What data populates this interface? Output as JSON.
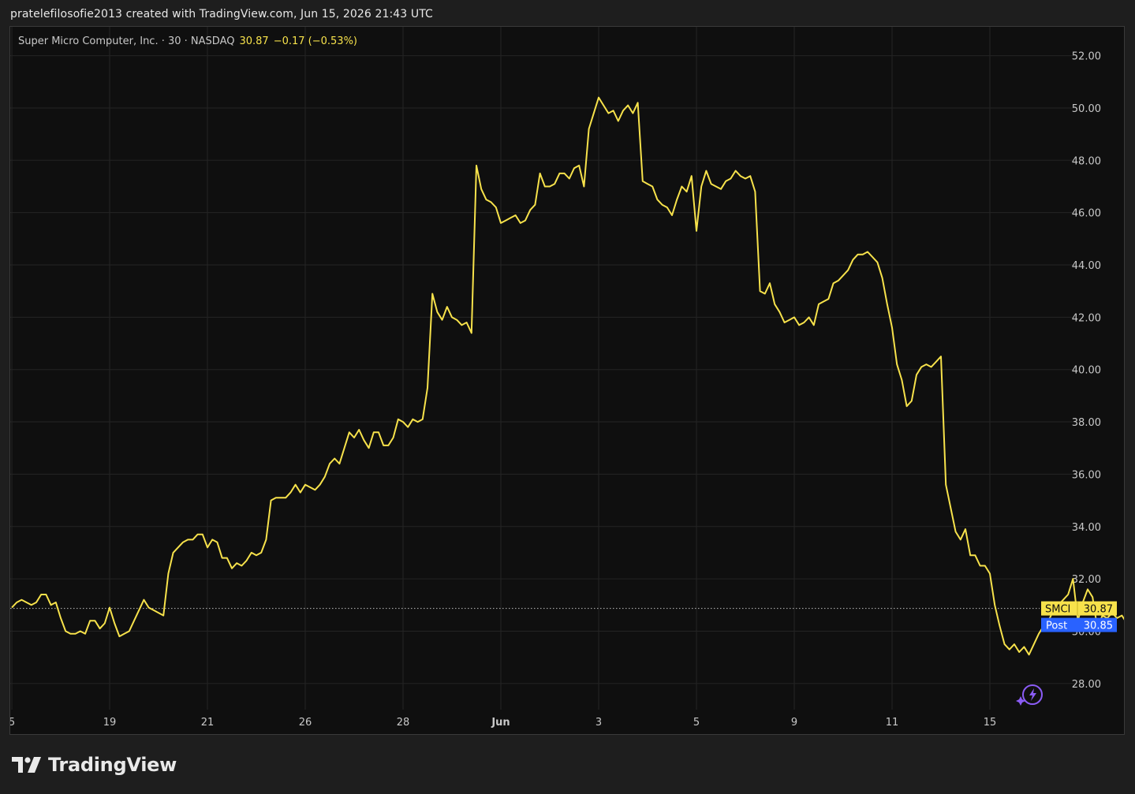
{
  "header": {
    "credit": "pratelefilosofie2013 created with TradingView.com, Jun 15, 2026 21:43 UTC"
  },
  "legend": {
    "name": "Super Micro Computer, Inc. · 30 · NASDAQ",
    "price": "30.87",
    "change": "−0.17 (−0.53%)"
  },
  "brand": {
    "name": "TradingView"
  },
  "labels": {
    "ticker_label": "SMCI",
    "ticker_value": "30.87",
    "post_label": "Post",
    "post_value": "30.85"
  },
  "colors": {
    "line": "#f7e24b",
    "background": "#0f0f0f",
    "grid": "#242424",
    "post": "#2962ff"
  },
  "icons": {
    "lightning": "lightning-icon",
    "logo": "tradingview-logo-icon"
  },
  "chart_data": {
    "type": "line",
    "title": "",
    "xlabel": "",
    "ylabel": "",
    "ylim": [
      27,
      52.5
    ],
    "grid": true,
    "yticks": [
      28,
      30,
      32,
      34,
      36,
      38,
      40,
      42,
      44,
      46,
      48,
      50,
      52
    ],
    "ytick_labels": [
      "28.00",
      "30.00",
      "32.00",
      "34.00",
      "36.00",
      "38.00",
      "40.00",
      "42.00",
      "44.00",
      "46.00",
      "48.00",
      "50.00",
      "52.00"
    ],
    "x_ticks": [
      {
        "label": "5",
        "pos": 0,
        "bold": false
      },
      {
        "label": "19",
        "pos": 20,
        "bold": false
      },
      {
        "label": "21",
        "pos": 40,
        "bold": false
      },
      {
        "label": "26",
        "pos": 60,
        "bold": false
      },
      {
        "label": "28",
        "pos": 80,
        "bold": false
      },
      {
        "label": "Jun",
        "pos": 100,
        "bold": true
      },
      {
        "label": "3",
        "pos": 120,
        "bold": false
      },
      {
        "label": "5",
        "pos": 140,
        "bold": false
      },
      {
        "label": "9",
        "pos": 160,
        "bold": false
      },
      {
        "label": "11",
        "pos": 180,
        "bold": false
      },
      {
        "label": "15",
        "pos": 200,
        "bold": false
      }
    ],
    "last_price": 30.87,
    "post_price": 30.85,
    "series": [
      {
        "name": "SMCI",
        "values": [
          30.9,
          31.1,
          31.2,
          31.1,
          31.0,
          31.1,
          31.4,
          31.4,
          31.0,
          31.1,
          30.5,
          30.0,
          29.9,
          29.9,
          30.0,
          29.9,
          30.4,
          30.4,
          30.1,
          30.3,
          30.9,
          30.3,
          29.8,
          29.9,
          30.0,
          30.4,
          30.8,
          31.2,
          30.9,
          30.8,
          30.7,
          30.6,
          32.2,
          33.0,
          33.2,
          33.4,
          33.5,
          33.5,
          33.7,
          33.7,
          33.2,
          33.5,
          33.4,
          32.8,
          32.8,
          32.4,
          32.6,
          32.5,
          32.7,
          33.0,
          32.9,
          33.0,
          33.5,
          35.0,
          35.1,
          35.1,
          35.1,
          35.3,
          35.6,
          35.3,
          35.6,
          35.5,
          35.4,
          35.6,
          35.9,
          36.4,
          36.6,
          36.4,
          37.0,
          37.6,
          37.4,
          37.7,
          37.3,
          37.0,
          37.6,
          37.6,
          37.1,
          37.1,
          37.4,
          38.1,
          38.0,
          37.8,
          38.1,
          38.0,
          38.1,
          39.3,
          42.9,
          42.2,
          41.9,
          42.4,
          42.0,
          41.9,
          41.7,
          41.8,
          41.4,
          47.8,
          46.9,
          46.5,
          46.4,
          46.2,
          45.6,
          45.7,
          45.8,
          45.9,
          45.6,
          45.7,
          46.1,
          46.3,
          47.5,
          47.0,
          47.0,
          47.1,
          47.5,
          47.5,
          47.3,
          47.7,
          47.8,
          47.0,
          49.2,
          49.8,
          50.4,
          50.1,
          49.8,
          49.9,
          49.5,
          49.9,
          50.1,
          49.8,
          50.2,
          47.2,
          47.1,
          47.0,
          46.5,
          46.3,
          46.2,
          45.9,
          46.5,
          47.0,
          46.8,
          47.4,
          45.3,
          47.0,
          47.6,
          47.1,
          47.0,
          46.9,
          47.2,
          47.3,
          47.6,
          47.4,
          47.3,
          47.4,
          46.8,
          43.0,
          42.9,
          43.3,
          42.5,
          42.2,
          41.8,
          41.9,
          42.0,
          41.7,
          41.8,
          42.0,
          41.7,
          42.5,
          42.6,
          42.7,
          43.3,
          43.4,
          43.6,
          43.8,
          44.2,
          44.4,
          44.4,
          44.5,
          44.3,
          44.1,
          43.5,
          42.5,
          41.6,
          40.2,
          39.6,
          38.6,
          38.8,
          39.8,
          40.1,
          40.2,
          40.1,
          40.3,
          40.5,
          35.6,
          34.7,
          33.8,
          33.5,
          33.9,
          32.9,
          32.9,
          32.5,
          32.5,
          32.2,
          31.0,
          30.2,
          29.5,
          29.3,
          29.5,
          29.2,
          29.4,
          29.1,
          29.5,
          29.9,
          30.2,
          30.4,
          30.8,
          31.0,
          31.2,
          31.4,
          32.0,
          30.4,
          31.1,
          31.6,
          31.3,
          30.1,
          30.6,
          30.5,
          30.7,
          30.5,
          30.6,
          30.3,
          30.7,
          30.6,
          31.2,
          31.4,
          31.3,
          31.2,
          31.2,
          31.0,
          31.2,
          31.1,
          31.1,
          31.0,
          30.87
        ]
      }
    ]
  }
}
